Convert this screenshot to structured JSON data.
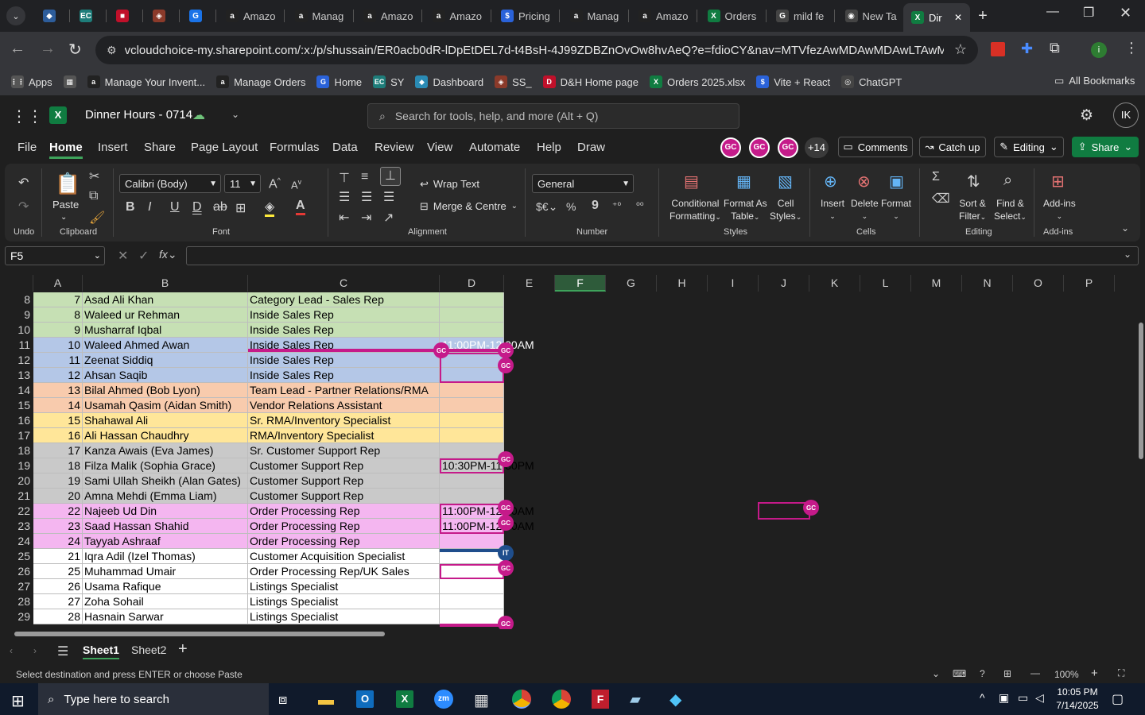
{
  "browser": {
    "tabs": [
      {
        "label": "",
        "color": "#2d5d9b",
        "glyph": "◆"
      },
      {
        "label": "",
        "color": "#1e7d7a",
        "glyph": "EC"
      },
      {
        "label": "",
        "color": "#c0102a",
        "glyph": "■"
      },
      {
        "label": "",
        "color": "#8b3a2a",
        "glyph": "◈"
      },
      {
        "label": "",
        "color": "#1a73e8",
        "glyph": "G"
      },
      {
        "label": "Amazo",
        "color": "#222",
        "glyph": "a"
      },
      {
        "label": "Manag",
        "color": "#222",
        "glyph": "a"
      },
      {
        "label": "Amazo",
        "color": "#222",
        "glyph": "a"
      },
      {
        "label": "Amazo",
        "color": "#222",
        "glyph": "a"
      },
      {
        "label": "Pricing",
        "color": "#2a62d9",
        "glyph": "$"
      },
      {
        "label": "Manag",
        "color": "#222",
        "glyph": "a"
      },
      {
        "label": "Amazo",
        "color": "#222",
        "glyph": "a"
      },
      {
        "label": "Orders",
        "color": "#107c41",
        "glyph": "X"
      },
      {
        "label": "mild fe",
        "color": "#444",
        "glyph": "G"
      },
      {
        "label": "New Ta",
        "color": "#444",
        "glyph": "◉"
      },
      {
        "label": "Dir",
        "color": "#107c41",
        "glyph": "X"
      }
    ],
    "url": "vcloudchoice-my.sharepoint.com/:x:/p/shussain/ER0acb0dR-lDpEtDEL7d-t4BsH-4J99ZDBZnOvOw8hvAeQ?e=fdioCY&nav=MTVfezAwMDAwMDAwLTAwMDEtMDAw...",
    "bookmarks": [
      {
        "label": "Apps",
        "color": "#555",
        "glyph": "⋮⋮"
      },
      {
        "label": "",
        "color": "#555",
        "glyph": "▦"
      },
      {
        "label": "Manage Your Invent...",
        "color": "#222",
        "glyph": "a"
      },
      {
        "label": "Manage Orders",
        "color": "#222",
        "glyph": "a"
      },
      {
        "label": "Home",
        "color": "#2a62d9",
        "glyph": "G"
      },
      {
        "label": "SY",
        "color": "#1e7d7a",
        "glyph": "EC"
      },
      {
        "label": "Dashboard",
        "color": "#2a8bb5",
        "glyph": "◆"
      },
      {
        "label": "SS_",
        "color": "#8b3a2a",
        "glyph": "◈"
      },
      {
        "label": "D&H Home page",
        "color": "#c0102a",
        "glyph": "D"
      },
      {
        "label": "Orders 2025.xlsx",
        "color": "#107c41",
        "glyph": "X"
      },
      {
        "label": "Vite + React",
        "color": "#2a62d9",
        "glyph": "$"
      },
      {
        "label": "ChatGPT",
        "color": "#444",
        "glyph": "◎"
      }
    ],
    "all_bookmarks": "All Bookmarks"
  },
  "excel": {
    "title": "Dinner Hours - 0714",
    "search_placeholder": "Search for tools, help, and more (Alt + Q)",
    "avatar": "IK",
    "menus": [
      "File",
      "Home",
      "Insert",
      "Share",
      "Page Layout",
      "Formulas",
      "Data",
      "Review",
      "View",
      "Automate",
      "Help",
      "Draw"
    ],
    "presence": [
      "GC",
      "GC",
      "GC"
    ],
    "presence_more": "+14",
    "comments": "Comments",
    "catchup": "Catch up",
    "editing": "Editing",
    "share": "Share",
    "ribbon": {
      "undo": "Undo",
      "paste": "Paste",
      "clipboard": "Clipboard",
      "font_name": "Calibri (Body)",
      "font_size": "11",
      "font": "Font",
      "wrap_text": "Wrap Text",
      "merge_centre": "Merge & Centre",
      "alignment": "Alignment",
      "number_format": "General",
      "number": "Number",
      "conditional": "Conditional",
      "formatting": "Formatting",
      "format_as": "Format As",
      "table": "Table",
      "cell": "Cell",
      "styles_btn": "Styles",
      "styles": "Styles",
      "insert": "Insert",
      "delete": "Delete",
      "format": "Format",
      "cells": "Cells",
      "sort": "Sort &",
      "filter": "Filter",
      "find": "Find &",
      "select": "Select",
      "editing": "Editing",
      "addins": "Add-ins",
      "addins_group": "Add-ins"
    },
    "namebox": "F5",
    "columns": [
      "A",
      "B",
      "C",
      "D",
      "E",
      "F",
      "G",
      "H",
      "I",
      "J",
      "K",
      "L",
      "M",
      "N",
      "O",
      "P"
    ],
    "rows": [
      {
        "r": "8",
        "n": "7",
        "name": "Asad Ali Khan",
        "role": "Category Lead - Sales Rep",
        "d": "",
        "color": "#c6e0b4"
      },
      {
        "r": "9",
        "n": "8",
        "name": "Waleed ur Rehman",
        "role": "Inside Sales Rep",
        "d": "",
        "color": "#c6e0b4"
      },
      {
        "r": "10",
        "n": "9",
        "name": "Musharraf Iqbal",
        "role": "Inside Sales Rep",
        "d": "",
        "color": "#c6e0b4"
      },
      {
        "r": "11",
        "n": "10",
        "name": "Waleed Ahmed Awan",
        "role": "Inside Sales Rep",
        "d": "11:00PM-12:00AM",
        "color": "#b4c7e7"
      },
      {
        "r": "12",
        "n": "11",
        "name": "Zeenat Siddiq",
        "role": "Inside Sales Rep",
        "d": "",
        "color": "#b4c7e7"
      },
      {
        "r": "13",
        "n": "12",
        "name": "Ahsan Saqib",
        "role": "Inside Sales Rep",
        "d": "",
        "color": "#b4c7e7"
      },
      {
        "r": "14",
        "n": "13",
        "name": "Bilal Ahmed (Bob Lyon)",
        "role": "Team Lead - Partner Relations/RMA",
        "d": "",
        "color": "#f8cbad"
      },
      {
        "r": "15",
        "n": "14",
        "name": "Usamah Qasim (Aidan Smith)",
        "role": "Vendor Relations Assistant",
        "d": "",
        "color": "#f8cbad"
      },
      {
        "r": "16",
        "n": "15",
        "name": "Shahawal Ali",
        "role": "Sr. RMA/Inventory Specialist",
        "d": "",
        "color": "#ffe699"
      },
      {
        "r": "17",
        "n": "16",
        "name": "Ali Hassan Chaudhry",
        "role": "RMA/Inventory Specialist",
        "d": "",
        "color": "#ffe699"
      },
      {
        "r": "18",
        "n": "17",
        "name": "Kanza Awais (Eva James)",
        "role": "Sr. Customer Support Rep",
        "d": "",
        "color": "#c9c9c9"
      },
      {
        "r": "19",
        "n": "18",
        "name": "Filza Malik (Sophia Grace)",
        "role": "Customer Support Rep",
        "d": "10:30PM-11:30PM",
        "color": "#c9c9c9"
      },
      {
        "r": "20",
        "n": "19",
        "name": "Sami Ullah Sheikh (Alan Gates)",
        "role": "Customer Support Rep",
        "d": "",
        "color": "#c9c9c9"
      },
      {
        "r": "21",
        "n": "20",
        "name": "Amna Mehdi (Emma Liam)",
        "role": "Customer Support Rep",
        "d": "",
        "color": "#c9c9c9"
      },
      {
        "r": "22",
        "n": "22",
        "name": "Najeeb Ud Din",
        "role": "Order Processing Rep",
        "d": "11:00PM-12:00AM",
        "color": "#f4b6f0"
      },
      {
        "r": "23",
        "n": "23",
        "name": "Saad Hassan Shahid",
        "role": "Order Processing Rep",
        "d": "11:00PM-12:00AM",
        "color": "#f4b6f0"
      },
      {
        "r": "24",
        "n": "24",
        "name": "Tayyab Ashraaf",
        "role": "Order Processing Rep",
        "d": "",
        "color": "#f4b6f0"
      },
      {
        "r": "25",
        "n": "21",
        "name": "Iqra Adil (Izel Thomas)",
        "role": "Customer Acquisition Specialist",
        "d": "",
        "color": "#ffffff"
      },
      {
        "r": "26",
        "n": "25",
        "name": "Muhammad Umair",
        "role": "Order Processing Rep/UK Sales",
        "d": "",
        "color": "#ffffff"
      },
      {
        "r": "27",
        "n": "26",
        "name": "Usama Rafique",
        "role": "Listings Specialist",
        "d": "",
        "color": "#ffffff"
      },
      {
        "r": "28",
        "n": "27",
        "name": "Zoha Sohail",
        "role": "Listings Specialist",
        "d": "",
        "color": "#ffffff"
      },
      {
        "r": "29",
        "n": "28",
        "name": "Hasnain Sarwar",
        "role": "Listings Specialist",
        "d": "",
        "color": "#ffffff"
      }
    ],
    "gc_badge": "GC",
    "it_badge": "IT",
    "sheets": [
      "Sheet1",
      "Sheet2"
    ],
    "status": "Select destination and press ENTER or choose Paste",
    "zoom": "100%"
  },
  "taskbar": {
    "search": "Type here to search",
    "time": "10:05 PM",
    "date": "7/14/2025"
  }
}
